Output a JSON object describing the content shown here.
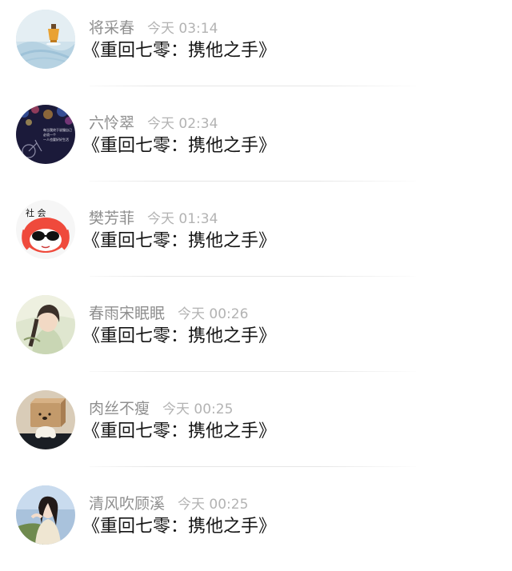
{
  "comments": [
    {
      "avatar_icon": "teacup-photo-avatar",
      "username": "将采春",
      "time": "今天 03:14",
      "text": "《重回七零：携他之手》"
    },
    {
      "avatar_icon": "night-bicycle-avatar",
      "username": "六怜翠",
      "time": "今天 02:34",
      "text": "《重回七零：携他之手》",
      "avatar_caption_lines": [
        "每当我终于说服自己",
        "必须一个",
        "一人也要好好生活"
      ]
    },
    {
      "avatar_icon": "cartoon-sunglasses-avatar",
      "username": "樊芳菲",
      "time": "今天 01:34",
      "text": "《重回七零：携他之手》",
      "avatar_caption": "社 会"
    },
    {
      "avatar_icon": "ancient-style-portrait-avatar",
      "username": "春雨宋眠眠",
      "time": "今天 00:26",
      "text": "《重回七零：携他之手》"
    },
    {
      "avatar_icon": "box-bear-toy-avatar",
      "username": "肉丝不瘦",
      "time": "今天 00:25",
      "text": "《重回七零：携他之手》"
    },
    {
      "avatar_icon": "girl-portrait-avatar",
      "username": "清风吹顾溪",
      "time": "今天 00:25",
      "text": "《重回七零：携他之手》"
    }
  ]
}
